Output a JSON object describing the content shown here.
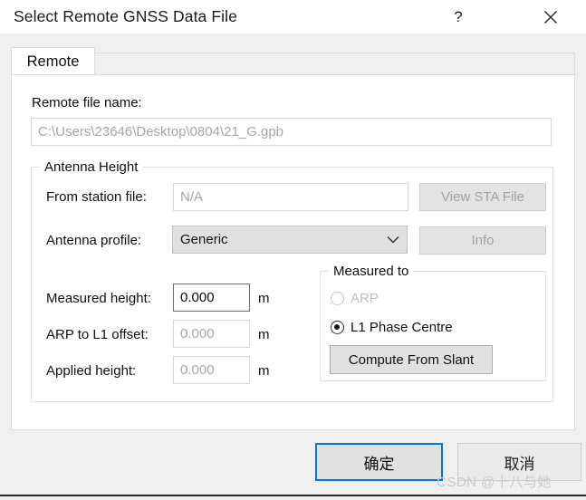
{
  "window": {
    "title": "Select Remote GNSS Data File",
    "help_icon": "question-mark-icon",
    "close_icon": "close-icon"
  },
  "tabs": [
    {
      "label": "Remote",
      "selected": true
    }
  ],
  "remote_file": {
    "label": "Remote file name:",
    "value": "C:\\Users\\23646\\Desktop\\0804\\21_G.gpb"
  },
  "antenna_height": {
    "caption": "Antenna Height",
    "from_station_file": {
      "label": "From station file:",
      "value": "N/A"
    },
    "view_sta_file_button": "View STA File",
    "antenna_profile": {
      "label": "Antenna profile:",
      "value": "Generic",
      "chevron_icon": "chevron-down-icon"
    },
    "info_button": "Info",
    "measured_height": {
      "label": "Measured height:",
      "value": "0.000",
      "unit": "m"
    },
    "arp_to_l1_offset": {
      "label": "ARP to L1 offset:",
      "value": "0.000",
      "unit": "m"
    },
    "applied_height": {
      "label": "Applied height:",
      "value": "0.000",
      "unit": "m"
    },
    "measured_to": {
      "caption": "Measured to",
      "options": [
        {
          "label": "ARP",
          "selected": false,
          "enabled": false
        },
        {
          "label": "L1 Phase Centre",
          "selected": true,
          "enabled": true
        }
      ],
      "compute_button": "Compute From Slant"
    }
  },
  "footer": {
    "ok_label": "确定",
    "cancel_label": "取消"
  },
  "watermark": {
    "text": "CSDN @十八与她"
  },
  "colors": {
    "accent": "#0078d7",
    "dialog_bg": "#f0f0f0",
    "panel_bg": "#ffffff",
    "control_bg": "#e1e1e1",
    "disabled_text": "#a6a6a6"
  }
}
